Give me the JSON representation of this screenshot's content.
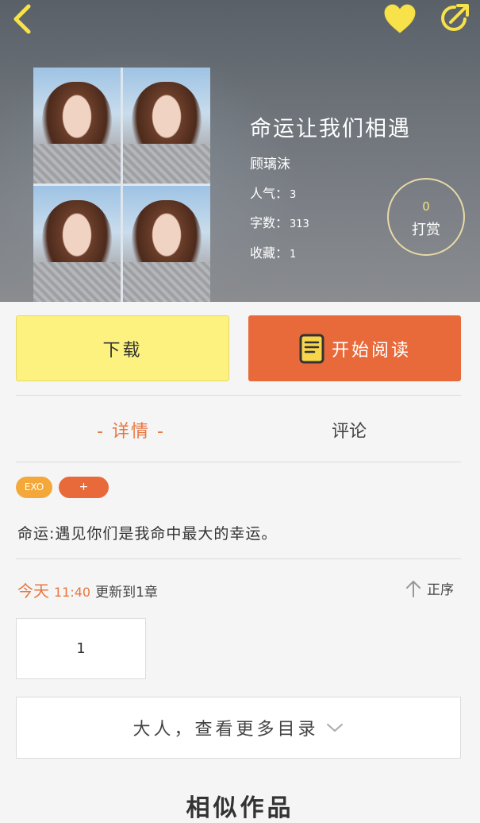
{
  "header": {
    "title": "命运让我们相遇",
    "author": "顾璃沫",
    "stats": [
      {
        "label": "人气：",
        "value": "3"
      },
      {
        "label": "字数：",
        "value": "313"
      },
      {
        "label": "收藏：",
        "value": "1"
      }
    ],
    "tip": {
      "count": "0",
      "label": "打赏"
    }
  },
  "icons": {
    "back": "chevron-left-icon",
    "favorite": "heart-icon",
    "share": "share-icon",
    "book": "book-icon",
    "sort": "arrow-up-icon",
    "expand": "chevron-down-icon"
  },
  "actions": {
    "download_label": "下载",
    "read_label": "开始阅读"
  },
  "tabs": {
    "detail_label": "- 详情 -",
    "comments_label": "评论"
  },
  "tags": [
    "EXO",
    "+"
  ],
  "intro": "命运:遇见你们是我命中最大的幸运。",
  "update": {
    "day": "今天",
    "time": "11:40",
    "text": "更新到1章",
    "sort_label": "正序"
  },
  "chapters": [
    "1"
  ],
  "more_toc_label": "大人，查看更多目录",
  "similar_title": "相似作品",
  "colors": {
    "accent_orange": "#e86a3a",
    "accent_yellow": "#fdf27f",
    "icon_yellow": "#f7e24a",
    "tag_orange": "#f4a83a"
  }
}
